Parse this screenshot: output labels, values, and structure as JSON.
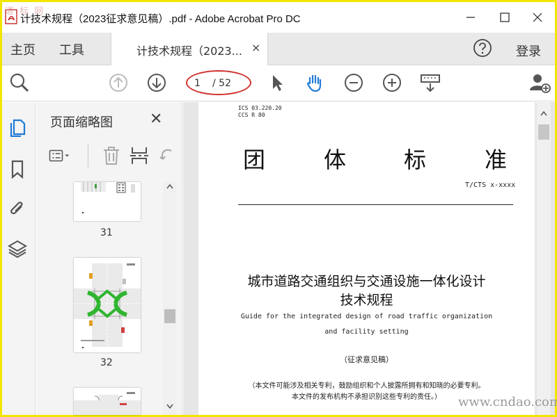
{
  "window": {
    "title": "计技术规程（2023征求意见稿）.pdf - Adobe Acrobat Pro DC",
    "watermark_top": "道 标 网"
  },
  "menu": {
    "home": "主页",
    "tools": "工具",
    "login": "登录"
  },
  "tab": {
    "label": "计技术规程（2023...",
    "close": "×"
  },
  "toolbar": {
    "current_page": "1",
    "total_pages": "/ 52"
  },
  "thumbnail_panel": {
    "title": "页面缩略图",
    "close": "✕",
    "pages": [
      {
        "number": "31"
      },
      {
        "number": "32"
      }
    ]
  },
  "document": {
    "ics": "ICS  03.220.20",
    "ccs": "CCS R 80",
    "big_chars": [
      "团",
      "体",
      "标",
      "准"
    ],
    "std_number": "T/CTS x-xxxx",
    "title_line1": "城市道路交通组织与交通设施一体化设计",
    "title_line2": "技术规程",
    "en_line1": "Guide for the integrated design of road traffic organization",
    "en_line2": "and facility setting",
    "draft": "（征求意见稿）",
    "note_line1": "（本文件可能涉及相关专利，鼓励组织和个人披露所拥有和知晓的必要专利。",
    "note_line2": "本文件的发布机构不承担识别这些专利的责任。）"
  },
  "watermark_bottom": "www.cndao.com",
  "colors": {
    "accent_blue": "#1f7ad6",
    "annotation_red": "#d0312d",
    "icon_gray": "#555555",
    "frame_yellow": "#f2e600"
  }
}
